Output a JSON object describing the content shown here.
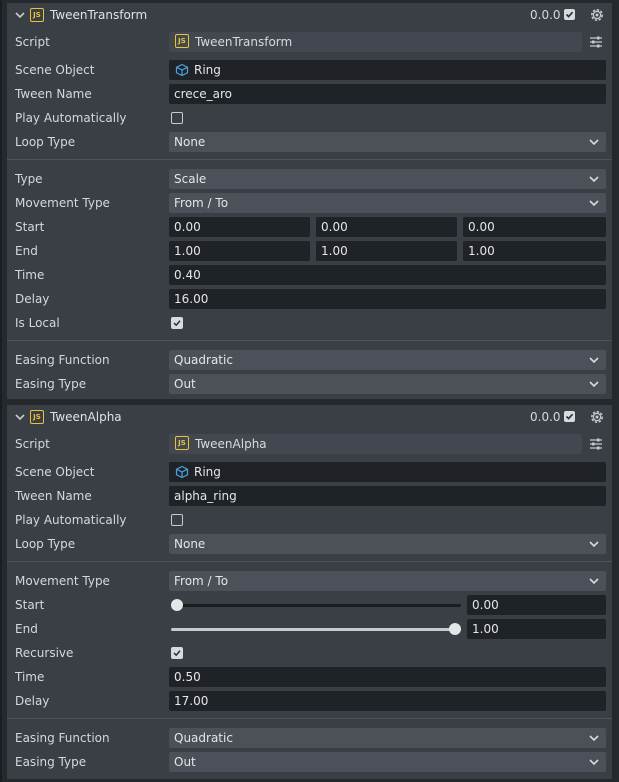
{
  "components": [
    {
      "name": "TweenTransform",
      "version": "0.0.0",
      "enabled": true,
      "script": "TweenTransform",
      "scene_object": "Ring",
      "tween_name": "crece_aro",
      "play_automatically": false,
      "loop_type": "None",
      "type": "Scale",
      "movement_type": "From / To",
      "start": [
        "0.00",
        "0.00",
        "0.00"
      ],
      "end": [
        "1.00",
        "1.00",
        "1.00"
      ],
      "time": "0.40",
      "delay": "16.00",
      "is_local": true,
      "easing_function": "Quadratic",
      "easing_type": "Out"
    },
    {
      "name": "TweenAlpha",
      "version": "0.0.0",
      "enabled": true,
      "script": "TweenAlpha",
      "scene_object": "Ring",
      "tween_name": "alpha_ring",
      "play_automatically": false,
      "loop_type": "None",
      "movement_type": "From / To",
      "start": "0.00",
      "start_level": 0.0,
      "end": "1.00",
      "end_level": 1.0,
      "recursive": true,
      "time": "0.50",
      "delay": "17.00",
      "easing_function": "Quadratic",
      "easing_type": "Out"
    }
  ],
  "labels": {
    "script": "Script",
    "scene_object": "Scene Object",
    "tween_name": "Tween Name",
    "play_automatically": "Play Automatically",
    "loop_type": "Loop Type",
    "type": "Type",
    "movement_type": "Movement Type",
    "start": "Start",
    "end": "End",
    "time": "Time",
    "delay": "Delay",
    "is_local": "Is Local",
    "recursive": "Recursive",
    "easing_function": "Easing Function",
    "easing_type": "Easing Type"
  },
  "icons": {
    "script_badge": "JS",
    "collapse": "chevron-down-icon",
    "settings": "gear-icon",
    "scene_object": "cube-icon",
    "script_options": "sliders-icon"
  },
  "colors": {
    "panel": "#3a3e45",
    "field": "#1f2227",
    "select": "#4b5059",
    "accent_js": "#e5c33a",
    "cube": "#4aa3e0"
  }
}
